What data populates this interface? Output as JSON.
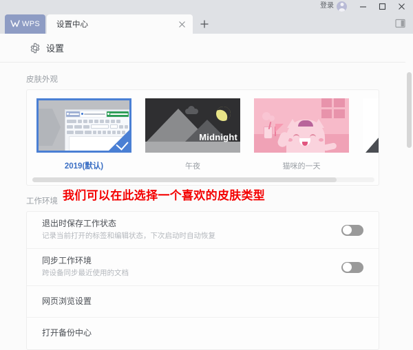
{
  "titlebar": {
    "login_label": "登录",
    "avatar_icon": "user-avatar-icon",
    "minimize_icon": "minimize-icon",
    "maximize_icon": "maximize-icon",
    "close_icon": "close-icon",
    "sidebar_toggle_icon": "sidebar-panel-icon"
  },
  "tabs": {
    "wps_label": "WPS",
    "wps_logo_icon": "wps-logo-icon",
    "active_tab_label": "设置中心",
    "tab_close_icon": "close-icon",
    "new_tab_icon": "plus-icon"
  },
  "page": {
    "gear_icon": "gear-icon",
    "title": "设置"
  },
  "skin": {
    "section_label": "皮肤外观",
    "items": [
      {
        "caption": "2019(默认)",
        "selected": true,
        "check_icon": "check-icon"
      },
      {
        "caption": "午夜",
        "selected": false,
        "badge_text": "Midnight"
      },
      {
        "caption": "猫咪的一天",
        "selected": false
      },
      {
        "caption": "",
        "selected": false
      }
    ]
  },
  "annotation": {
    "text": "我们可以在此选择一个喜欢的皮肤类型",
    "color": "#f40000"
  },
  "workspace": {
    "section_label": "工作环境",
    "rows": [
      {
        "title": "退出时保存工作状态",
        "desc": "记录当前打开的标签和编辑状态，下次启动时自动恢复",
        "toggle": "off"
      },
      {
        "title": "同步工作环境",
        "desc": "跨设备同步最近使用的文档",
        "toggle": "off"
      },
      {
        "title": "网页浏览设置",
        "desc": "",
        "toggle": null
      },
      {
        "title": "打开备份中心",
        "desc": "",
        "toggle": null
      }
    ]
  },
  "colors": {
    "accent": "#4a7fd4",
    "wps_tab": "#8e9cc4",
    "window_bg": "#dfe1e5",
    "content_bg": "#fbfbfb"
  }
}
